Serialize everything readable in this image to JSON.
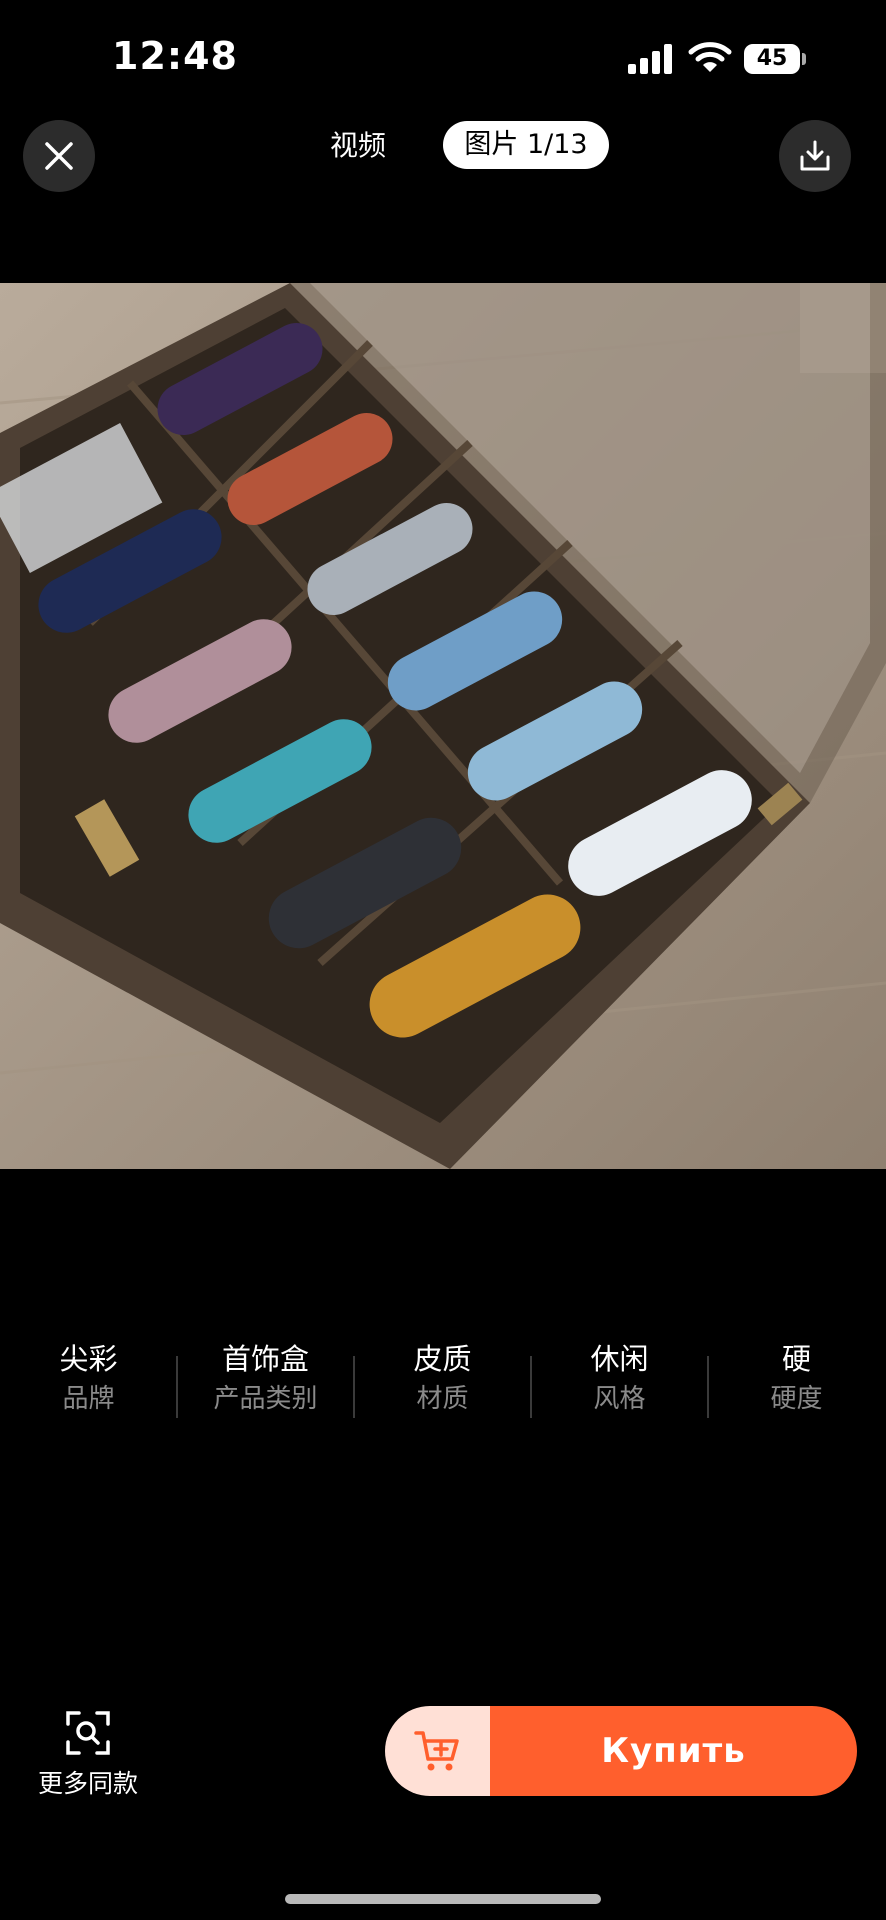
{
  "status_bar": {
    "time": "12:48",
    "battery": "45"
  },
  "top_nav": {
    "tab_video": "视频",
    "tab_photo": "图片 1/13"
  },
  "attributes": [
    {
      "value": "尖彩",
      "label": "品牌"
    },
    {
      "value": "首饰盒",
      "label": "产品类别"
    },
    {
      "value": "皮质",
      "label": "材质"
    },
    {
      "value": "休闲",
      "label": "风格"
    },
    {
      "value": "硬",
      "label": "硬度"
    }
  ],
  "bottom_bar": {
    "more_same_label": "更多同款",
    "buy_label": "Купить"
  },
  "colors": {
    "accent": "#ff5f2d",
    "cart_bg": "#ffe0d6"
  }
}
